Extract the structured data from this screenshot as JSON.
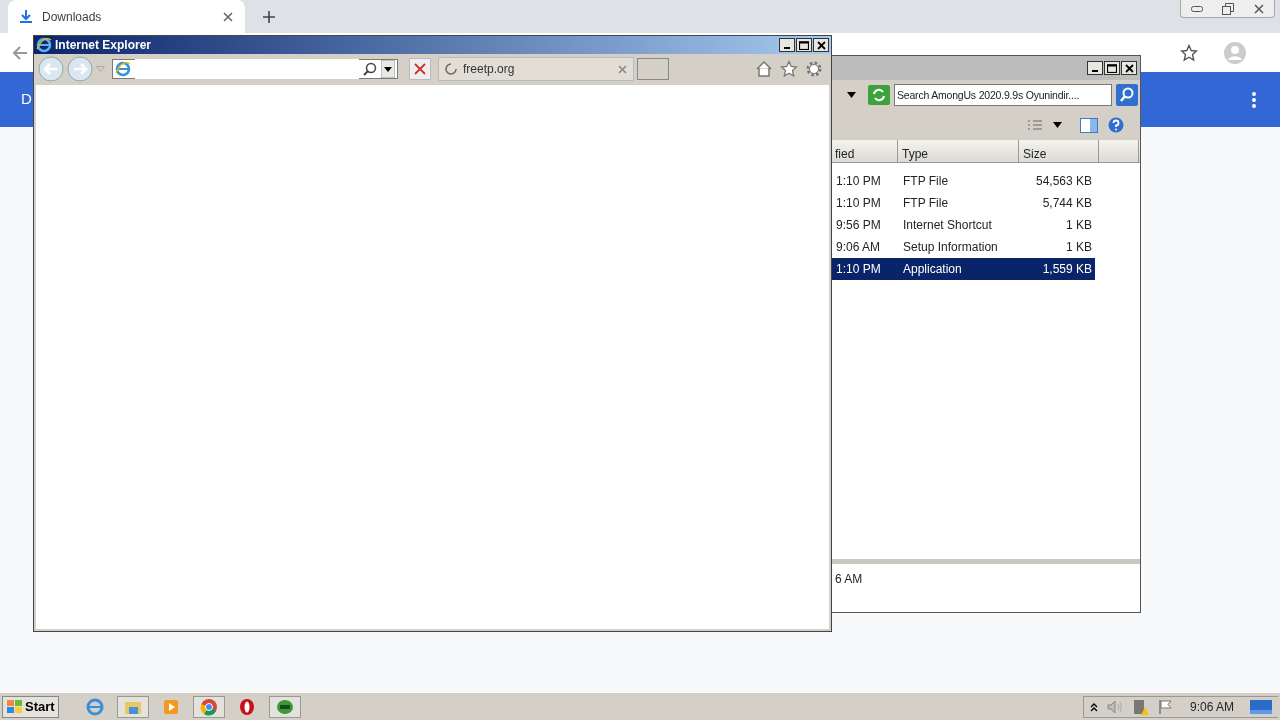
{
  "chrome": {
    "tabs": [
      {
        "label": "Downloads",
        "selected": true
      }
    ],
    "header_text": "D"
  },
  "explorer": {
    "search": {
      "placeholder": "Search AmongUs 2020.9.9s Oyunindir...."
    },
    "columns": [
      "fied",
      "Type",
      "Size"
    ],
    "rows": [
      {
        "modified": "1:10 PM",
        "type": "FTP File",
        "size": "54,563 KB",
        "selected": false
      },
      {
        "modified": "1:10 PM",
        "type": "FTP File",
        "size": "5,744 KB",
        "selected": false
      },
      {
        "modified": "9:56 PM",
        "type": "Internet Shortcut",
        "size": "1 KB",
        "selected": false
      },
      {
        "modified": "9:06 AM",
        "type": "Setup Information",
        "size": "1 KB",
        "selected": false
      },
      {
        "modified": "1:10 PM",
        "type": "Application",
        "size": "1,559 KB",
        "selected": true
      }
    ],
    "details_text": "6 AM"
  },
  "ie": {
    "title": "Internet Explorer",
    "tabs": [
      {
        "label": "freetp.org",
        "selected": true
      }
    ]
  },
  "taskbar": {
    "start": "Start",
    "clock": "9:06 AM"
  }
}
